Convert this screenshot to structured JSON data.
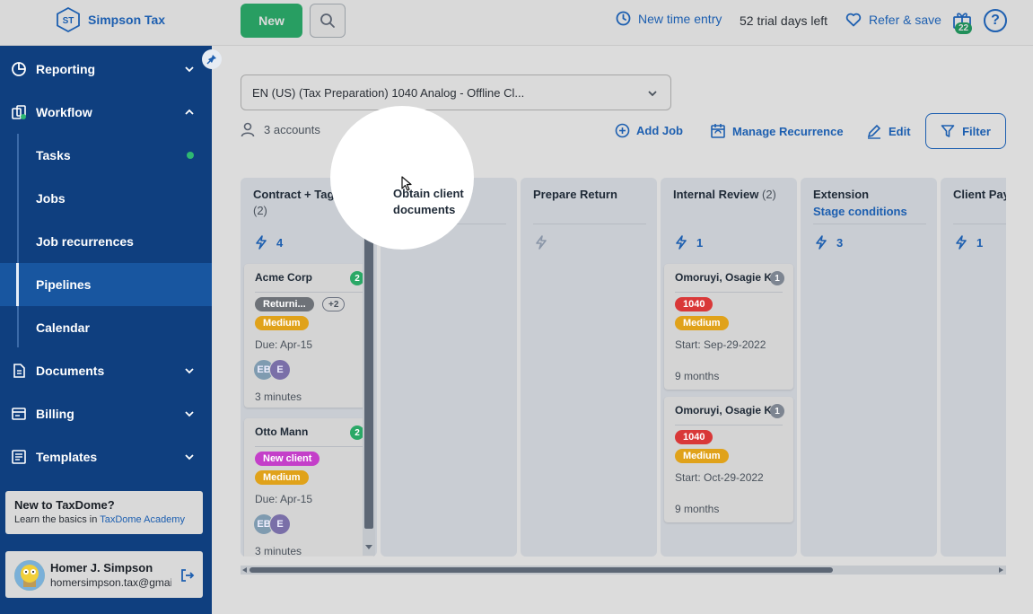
{
  "brand": {
    "initials": "ST",
    "name": "Simpson Tax"
  },
  "topbar": {
    "new_label": "New",
    "time_entry_label": "New time entry",
    "trial_text": "52 trial days left",
    "refer_label": "Refer & save",
    "gift_count": "22",
    "help_glyph": "?"
  },
  "sidebar": {
    "items": [
      {
        "label": "Reporting",
        "icon": "pie-chart-icon"
      },
      {
        "label": "Workflow",
        "icon": "workflow-icon"
      },
      {
        "label": "Documents",
        "icon": "documents-icon"
      },
      {
        "label": "Billing",
        "icon": "billing-icon"
      },
      {
        "label": "Templates",
        "icon": "templates-icon"
      }
    ],
    "workflow_sub": [
      {
        "label": "Tasks"
      },
      {
        "label": "Jobs"
      },
      {
        "label": "Job recurrences"
      },
      {
        "label": "Pipelines"
      },
      {
        "label": "Calendar"
      }
    ],
    "promo": {
      "title": "New to TaxDome?",
      "text": "Learn the basics in ",
      "link": "TaxDome Academy"
    },
    "user": {
      "name": "Homer J. Simpson",
      "email": "homersimpson.tax@gmail.com"
    }
  },
  "toolbar": {
    "pipeline": "EN (US) (Tax Preparation) 1040 Analog - Offline Cl...",
    "accounts": "3 accounts",
    "add_job": "Add Job",
    "manage_recurrence": "Manage Recurrence",
    "edit": "Edit",
    "filter": "Filter"
  },
  "board": {
    "columns": [
      {
        "title": "Contract + Tags",
        "count": "(2)",
        "automations": "4",
        "cards": [
          {
            "title": "Acme Corp",
            "count": "2",
            "tags": [
              "Returni...",
              "Medium"
            ],
            "extra": "+2",
            "meta": "Due: Apr-15",
            "avatars": [
              "EB",
              "E"
            ],
            "time": "3 minutes"
          },
          {
            "title": "Otto Mann",
            "count": "2",
            "tags": [
              "New client",
              "Medium"
            ],
            "meta": "Due: Apr-15",
            "avatars": [
              "EB",
              "E"
            ],
            "time": "3 minutes"
          }
        ]
      },
      {
        "title": "Obtain client documents",
        "count": "",
        "automations": ""
      },
      {
        "title": "Prepare Return",
        "count": "",
        "automations": ""
      },
      {
        "title": "Internal Review",
        "count": "(2)",
        "automations": "1",
        "cards": [
          {
            "title": "Omoruyi, Osagie K.",
            "count": "1",
            "tags": [
              "1040",
              "Medium"
            ],
            "meta": "Start: Sep-29-2022",
            "time": "9 months"
          },
          {
            "title": "Omoruyi, Osagie K.",
            "count": "1",
            "tags": [
              "1040",
              "Medium"
            ],
            "meta": "Start: Oct-29-2022",
            "time": "9 months"
          }
        ]
      },
      {
        "title": "Extension",
        "count": "",
        "link": "Stage conditions",
        "automations": "3"
      },
      {
        "title": "Client Pay",
        "count": "",
        "automations": "1"
      }
    ]
  },
  "colors": {
    "primary": "#1d5fb0",
    "sidebar": "#0f3f7f",
    "green": "#2eb872",
    "tag_gray": "#6e7278",
    "tag_orange": "#e0a21a",
    "tag_magenta": "#c43fc9",
    "tag_red": "#d93838"
  }
}
